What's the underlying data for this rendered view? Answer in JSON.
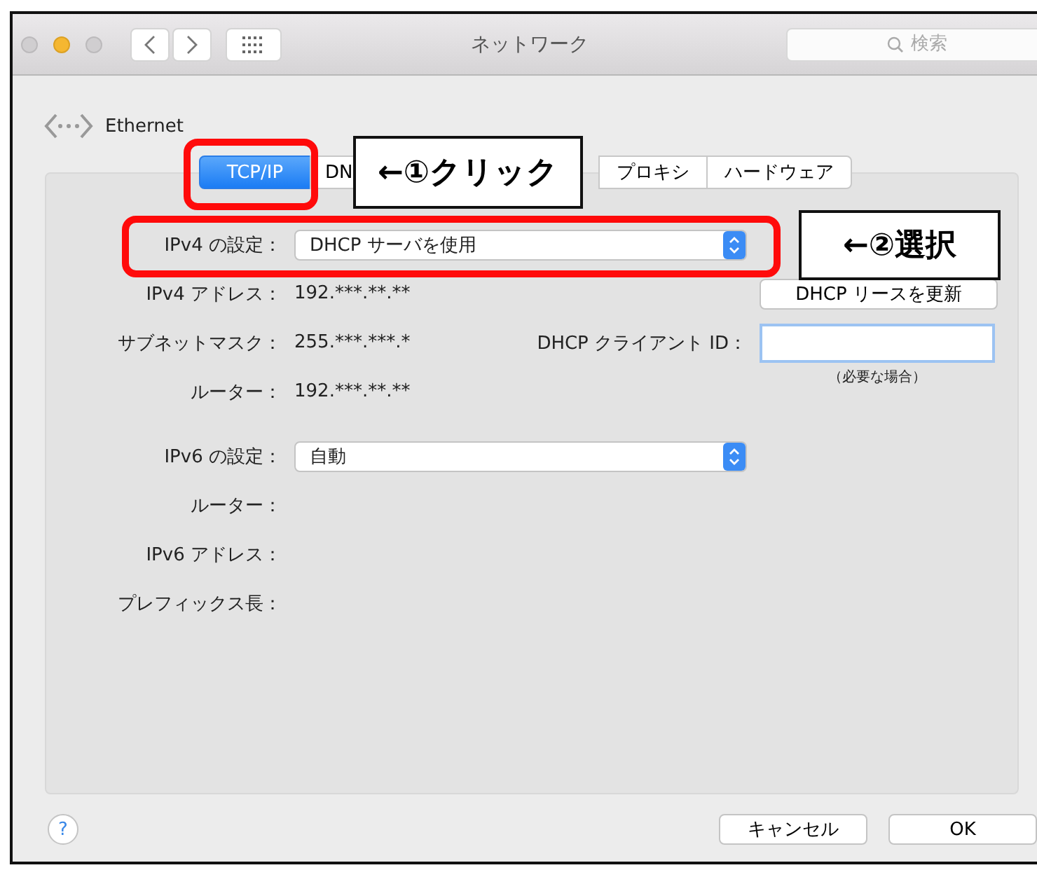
{
  "window": {
    "title": "ネットワーク",
    "search": {
      "placeholder": "検索"
    }
  },
  "service": {
    "name": "Ethernet"
  },
  "tabs": [
    {
      "label": "TCP/IP",
      "selected": true
    },
    {
      "label": "DN",
      "selected": false
    },
    {
      "label": "プロキシ",
      "selected": false
    },
    {
      "label": "ハードウェア",
      "selected": false
    }
  ],
  "fields": [
    {
      "kind": "popup",
      "label": "IPv4 の設定：",
      "value": "DHCP サーバを使用"
    },
    {
      "kind": "text",
      "label": "IPv4 アドレス：",
      "value": "192.***.**.**"
    },
    {
      "kind": "text",
      "label": "サブネットマスク：",
      "value": "255.***.***.*"
    },
    {
      "kind": "text",
      "label": "ルーター：",
      "value": "192.***.**.**"
    },
    {
      "kind": "popup",
      "label": "IPv6 の設定：",
      "value": "自動"
    },
    {
      "kind": "text",
      "label": "ルーター："
    },
    {
      "kind": "text",
      "label": "IPv6 アドレス："
    },
    {
      "kind": "text",
      "label": "プレフィックス長："
    }
  ],
  "renew_button": "DHCP リースを更新",
  "client_id": {
    "label": "DHCP クライアント ID：",
    "note": "（必要な場合）"
  },
  "help_button": "?",
  "buttons": [
    "キャンセル",
    "OK"
  ],
  "annotations": [
    {
      "kind": "highlight"
    },
    {
      "kind": "highlight"
    },
    {
      "kind": "callout",
      "text": "←①クリック"
    },
    {
      "kind": "callout",
      "text": "←②選択"
    }
  ]
}
